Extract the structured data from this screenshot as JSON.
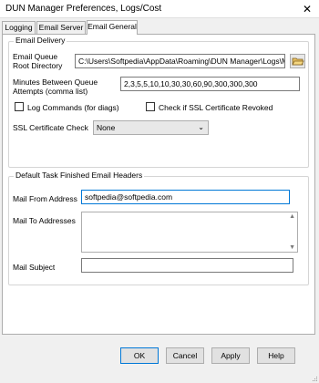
{
  "window": {
    "title": "DUN Manager Preferences, Logs/Cost"
  },
  "tabs": [
    {
      "label": "Logging"
    },
    {
      "label": "Email Server"
    },
    {
      "label": "Email General"
    }
  ],
  "email_delivery": {
    "title": "Email Delivery",
    "queue_dir_label_1": "Email Queue",
    "queue_dir_label_2": "Root Directory",
    "queue_dir_value": "C:\\Users\\Softpedia\\AppData\\Roaming\\DUN Manager\\Logs\\MailQ",
    "minutes_label_1": "Minutes Between Queue",
    "minutes_label_2": "Attempts (comma list)",
    "minutes_value": "2,3,5,5,10,10,30,30,60,90,300,300,300",
    "log_commands_label": "Log Commands (for diags)",
    "check_ssl_label": "Check if SSL Certificate Revoked",
    "ssl_check_label": "SSL Certificate Check",
    "ssl_check_value": "None"
  },
  "headers": {
    "title": "Default Task Finished Email Headers",
    "from_label": "Mail From Address",
    "from_value": "softpedia@softpedia.com",
    "to_label": "Mail To Addresses",
    "to_value": "",
    "subject_label": "Mail Subject",
    "subject_value": ""
  },
  "buttons": {
    "ok": "OK",
    "cancel": "Cancel",
    "apply": "Apply",
    "help": "Help"
  }
}
